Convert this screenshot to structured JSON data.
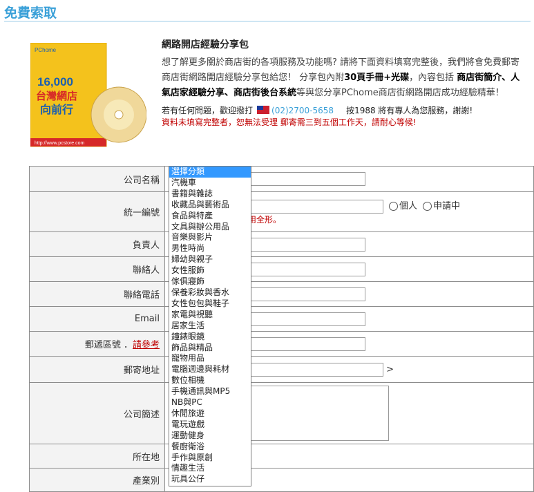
{
  "header": {
    "title": "免費索取"
  },
  "intro": {
    "heading": "網路開店經驗分享包",
    "p1": "想了解更多關於商店街的各項服務及功能嗎? 請將下面資料填寫完整後，我們將會免費郵寄商店街網路開店經驗分享包給您！ 分享包內附",
    "p1_bold1": "30頁手冊+光碟",
    "p1_mid": "，內容包括 ",
    "p1_bold2": "商店街簡介、人氣店家經驗分享、商店街後台系統",
    "p1_end": "等與您分享PChome商店街網路開店成功經驗精華！",
    "contact_prefix": "若有任何問題，歡迎撥打",
    "phone": "(02)2700-5658",
    "contact_suffix": "按1988 將有專人為您服務，謝謝!",
    "notice": "資料未填寫完整者，恕無法受理 郵寄需三到五個工作天，請耐心等候!"
  },
  "form": {
    "company_label": "公司名稱",
    "taxid_label": "統一編號",
    "taxid_opt1": "個人",
    "taxid_opt2": "申請中",
    "taxid_hint": "用全形。",
    "owner_label": "負責人",
    "contact_label": "聯絡人",
    "phone_label": "聯絡電話",
    "email_label": "Email",
    "zip_label": "郵遞區號 ．",
    "zip_link": "請參考",
    "address_label": "郵寄地址",
    "address_suffix": ">",
    "desc_label": "公司簡述",
    "location_label": "所在地",
    "industry_label": "產業別"
  },
  "dropdown": {
    "selected": "選擇分類",
    "options": [
      "選擇分類",
      "汽機車",
      "書籍與雜誌",
      "收藏品與藝術品",
      "食品與特產",
      "文具與辦公用品",
      "音樂與影片",
      "男性時尚",
      "婦幼與親子",
      "女性服飾",
      "傢俱寢飾",
      "保養彩妝與香水",
      "女性包包與鞋子",
      "家電與視聽",
      "居家生活",
      "鐘錶眼鏡",
      "飾品與精品",
      "寵物用品",
      "電腦週邊與耗材",
      "數位相機",
      "手機通訊與MP5",
      "NB與PC",
      "休閒旅遊",
      "電玩遊戲",
      "運動健身",
      "餐廚衛浴",
      "手作與原創",
      "情趣生活",
      "玩具公仔"
    ]
  },
  "promo": {
    "brand": "PChome",
    "number": "16,000",
    "line1": "台灣網店",
    "line2": "向前行",
    "url": "http://www.pcstore.com"
  }
}
